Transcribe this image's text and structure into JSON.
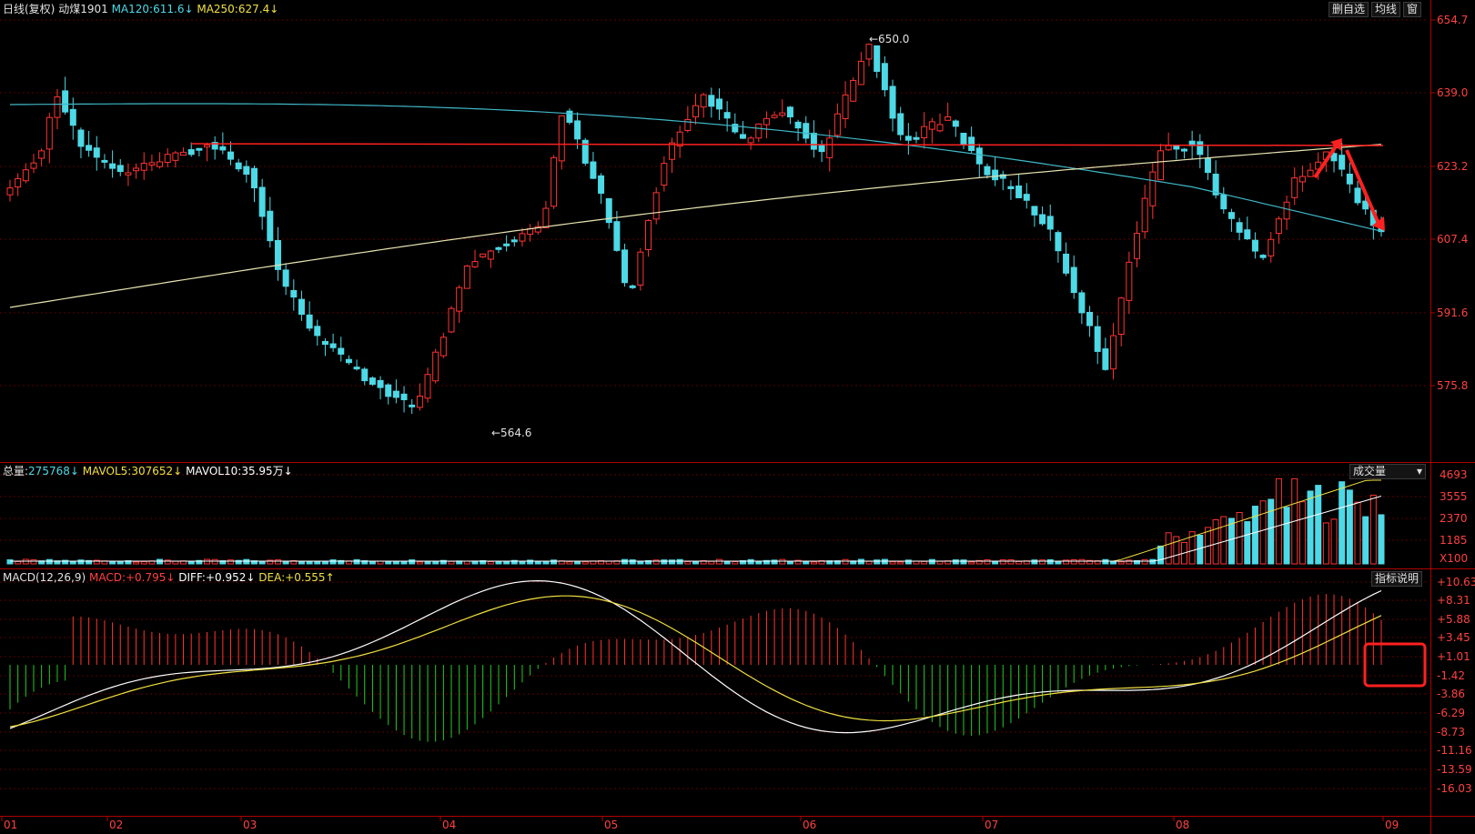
{
  "header": {
    "period": "日线(复权)",
    "symbol": "动煤1901",
    "ma120_label": "MA120:",
    "ma120_value": "611.6↓",
    "ma250_label": "MA250:",
    "ma250_value": "627.4↓"
  },
  "toolbar": {
    "delete_watch": "删自选",
    "ma_button": "均线",
    "window_button": "窗"
  },
  "price_axis": [
    "654.7",
    "639.0",
    "623.2",
    "607.4",
    "591.6",
    "575.8"
  ],
  "price_annotations": {
    "high": "650.0",
    "low": "564.6"
  },
  "volume_panel": {
    "total_label": "总量:",
    "total_value": "275768↓",
    "mavol5_label": "MAVOL5:",
    "mavol5_value": "307652↓",
    "mavol10_label": "MAVOL10:",
    "mavol10_value": "35.95万↓",
    "selector": "成交量",
    "axis": [
      "4693",
      "3555",
      "2370",
      "1185",
      "X100"
    ]
  },
  "macd_panel": {
    "name": "MACD(12,26,9)",
    "macd_label": "MACD:",
    "macd_value": "+0.795↓",
    "diff_label": "DIFF:",
    "diff_value": "+0.952↓",
    "dea_label": "DEA:",
    "dea_value": "+0.555↑",
    "help_button": "指标说明",
    "axis": [
      "+10.63",
      "+8.31",
      "+5.88",
      "+3.45",
      "+1.01",
      "-1.42",
      "-3.86",
      "-6.29",
      "-8.73",
      "-11.16",
      "-13.59",
      "-16.03"
    ]
  },
  "time_axis": [
    "01",
    "02",
    "03",
    "04",
    "05",
    "06",
    "07",
    "08",
    "09"
  ],
  "colors": {
    "background": "#000000",
    "up": "#ff3333",
    "down": "#4dd9e6",
    "ma120": "#3fb8c8",
    "ma250": "#e8e4b0",
    "frame": "#b00000",
    "diff": "#ffffff",
    "dea": "#f0e040",
    "macd_pos": "#ff3333",
    "macd_neg": "#22cc22",
    "annotation": "#ff2020"
  }
}
